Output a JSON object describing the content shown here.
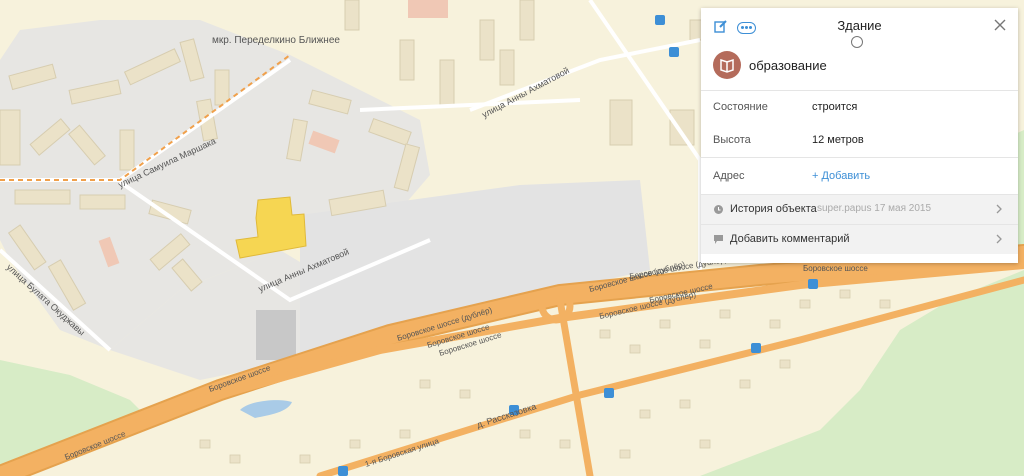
{
  "panel": {
    "title": "Здание",
    "category": "образование",
    "rows": [
      {
        "key": "Состояние",
        "value": "строится"
      },
      {
        "key": "Высота",
        "value": "12 метров"
      }
    ],
    "address": {
      "key": "Адрес",
      "action": "+ Добавить"
    },
    "history": {
      "label": "История объекта",
      "meta": "super.papus 17 мая 2015"
    },
    "comment": {
      "label": "Добавить комментарий"
    }
  },
  "map_labels": {
    "district": "мкр. Переделкино Ближнее",
    "street_samuil": "улица Самуила Маршака",
    "street_anny_top": "улица Анны Ахматовой",
    "street_anny_bottom": "улица Анны Ахматовой",
    "street_bulat": "улица Булата Окуджавы",
    "borovskoe_dubler_1": "Боровское шоссе (дублёр)",
    "borovskoe_1": "Боровское шоссе",
    "borovskoe_2": "Боровское шоссе",
    "borovskoe_dubler_2": "Боровское шоссе (дублёр)",
    "borovskoe_dubler_3": "Боровское шоссе (дублёр)",
    "borovskoe_3": "Боровское шоссе",
    "borovskoe_dubler_4": "Боровское шоссе (дублёр)",
    "borovskoe_4": "Боровское шоссе",
    "borovskoe_5": "Боровское шоссе",
    "borovskoe_6": "Боровское шоссе",
    "rasskazovka": "д. Рассказовка",
    "borovskaya_1": "1-я Боровская улица"
  },
  "colors": {
    "background": "#f7f2dc",
    "highway": "#f3b162",
    "road": "#ffffff",
    "building": "#ebe2c8",
    "highlight_building": "#f6d652",
    "industrial": "#e3e3e3",
    "water": "#a9cbe7",
    "park": "#d7ecc6",
    "accent": "#3d8fd6"
  }
}
